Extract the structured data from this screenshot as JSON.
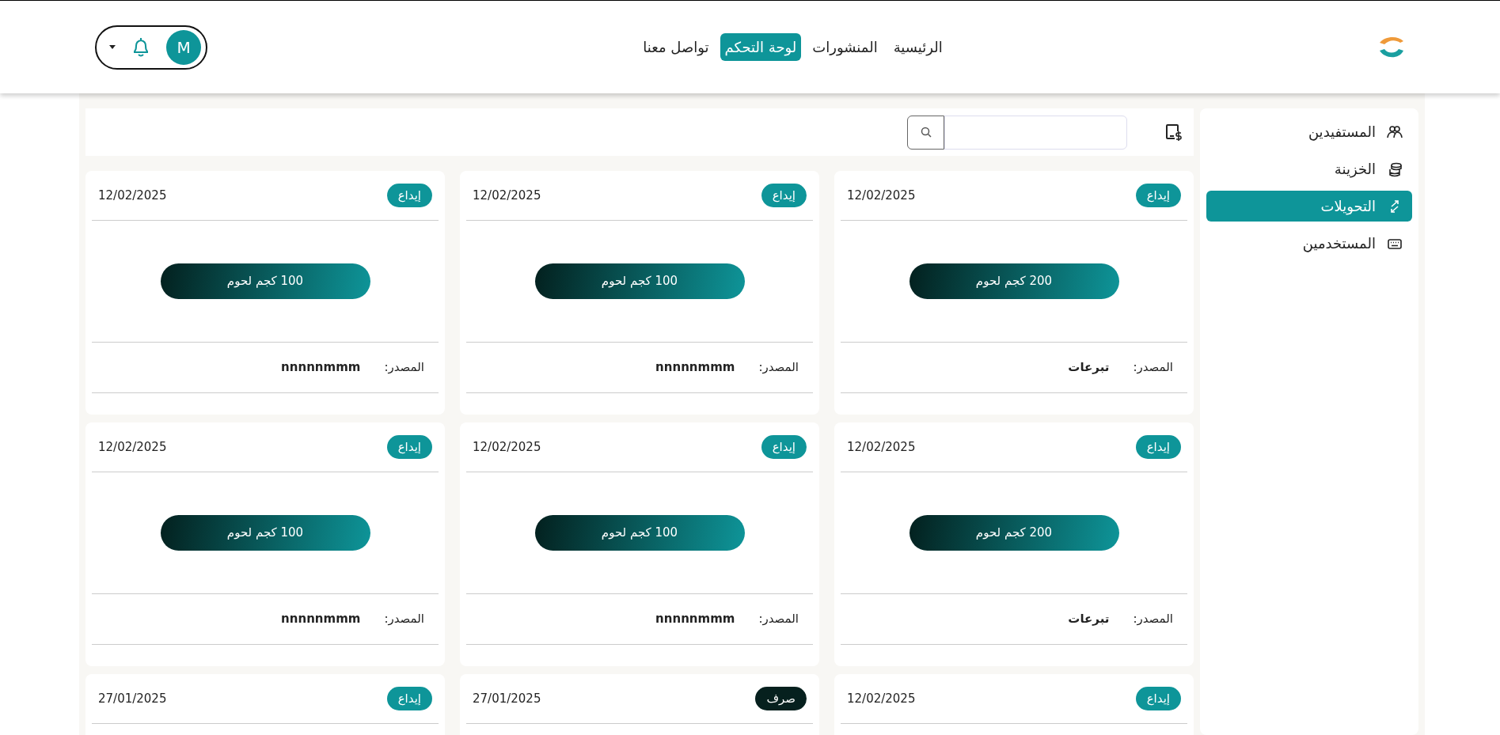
{
  "header": {
    "nav": [
      {
        "label": "الرئيسية",
        "selected": false
      },
      {
        "label": "المنشورات",
        "selected": false
      },
      {
        "label": "لوحة التحكم",
        "selected": true
      },
      {
        "label": "تواصل معنا",
        "selected": false
      }
    ],
    "avatar": "M"
  },
  "sidebar": {
    "items": [
      {
        "label": "المستفيدين",
        "selected": false
      },
      {
        "label": "الخزينة",
        "selected": false
      },
      {
        "label": "التحويلات",
        "selected": true
      },
      {
        "label": "المستخدمين",
        "selected": false
      }
    ]
  },
  "cards": [
    {
      "kind": "deposit",
      "badge": "إيداع",
      "date": "12/02/2025",
      "amount": "200 كجم لحوم",
      "source_label": "المصدر:",
      "source": "تبرعات"
    },
    {
      "kind": "deposit",
      "badge": "إيداع",
      "date": "12/02/2025",
      "amount": "100 كجم لحوم",
      "source_label": "المصدر:",
      "source": "nnnnnmmm"
    },
    {
      "kind": "deposit",
      "badge": "إيداع",
      "date": "12/02/2025",
      "amount": "100 كجم لحوم",
      "source_label": "المصدر:",
      "source": "nnnnnmmm"
    },
    {
      "kind": "deposit",
      "badge": "إيداع",
      "date": "12/02/2025",
      "amount": "200 كجم لحوم",
      "source_label": "المصدر:",
      "source": "تبرعات"
    },
    {
      "kind": "deposit",
      "badge": "إيداع",
      "date": "12/02/2025",
      "amount": "100 كجم لحوم",
      "source_label": "المصدر:",
      "source": "nnnnnmmm"
    },
    {
      "kind": "deposit",
      "badge": "إيداع",
      "date": "12/02/2025",
      "amount": "100 كجم لحوم",
      "source_label": "المصدر:",
      "source": "nnnnnmmm"
    },
    {
      "kind": "deposit",
      "badge": "إيداع",
      "date": "12/02/2025"
    },
    {
      "kind": "withdraw",
      "badge": "صرف",
      "date": "27/01/2025"
    },
    {
      "kind": "deposit",
      "badge": "إيداع",
      "date": "27/01/2025"
    }
  ]
}
